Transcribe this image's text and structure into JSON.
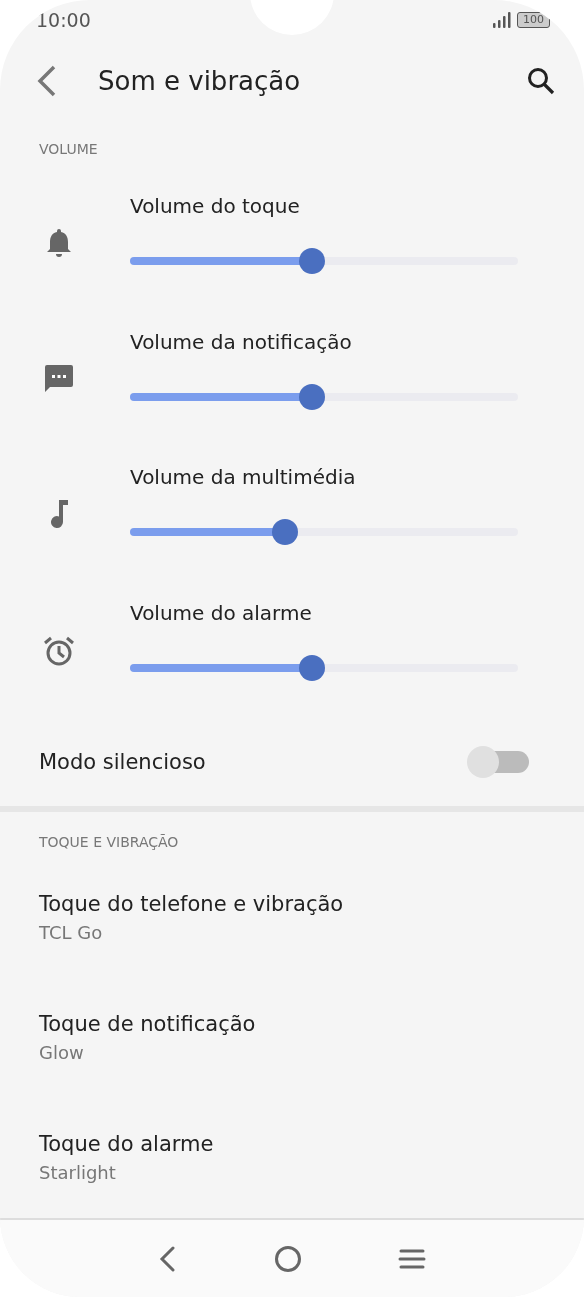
{
  "status_bar": {
    "time": "10:00",
    "battery": "100"
  },
  "header": {
    "title": "Som e vibração"
  },
  "volume_section": {
    "title": "VOLUME",
    "sliders": [
      {
        "label": "Volume do toque",
        "kind": "bell",
        "level": 0.47
      },
      {
        "label": "Volume da notificação",
        "kind": "message",
        "level": 0.47
      },
      {
        "label": "Volume da multimédia",
        "kind": "music",
        "level": 0.4
      },
      {
        "label": "Volume do alarme",
        "kind": "alarm",
        "level": 0.47
      }
    ],
    "silent_mode": {
      "label": "Modo silencioso",
      "on": false
    }
  },
  "ringtone_section": {
    "title": "TOQUE E VIBRAÇÃO",
    "items": [
      {
        "title": "Toque do telefone e vibração",
        "value": "TCL Go"
      },
      {
        "title": "Toque de notificação",
        "value": "Glow"
      },
      {
        "title": "Toque do alarme",
        "value": "Starlight"
      }
    ]
  }
}
